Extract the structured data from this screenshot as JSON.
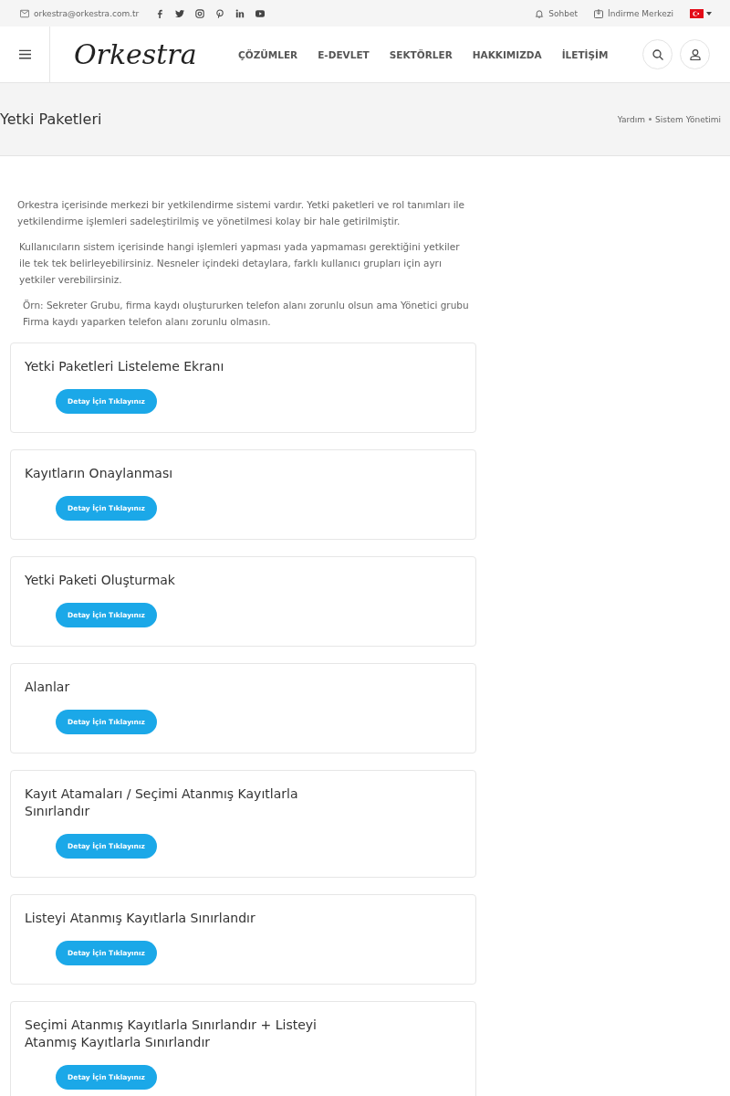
{
  "topbar": {
    "email": "orkestra@orkestra.com.tr",
    "links": [
      "Sohbet",
      "İndirme Merkezi"
    ]
  },
  "header": {
    "logo": "Orkestra",
    "nav": [
      "ÇÖZÜMLER",
      "E-DEVLET",
      "SEKTÖRLER",
      "HAKKIMIZDA",
      "İLETİŞİM"
    ]
  },
  "page_title": "Yetki Paketleri",
  "breadcrumb": [
    "Yardım",
    "Sistem Yönetimi"
  ],
  "paragraphs": [
    "Orkestra içerisinde merkezi bir yetkilendirme sistemi vardır. Yetki paketleri ve rol tanımları ile yetkilendirme işlemleri sadeleştirilmiş ve yönetilmesi kolay bir hale getirilmiştir.",
    "Kullanıcıların sistem içerisinde hangi işlemleri yapması yada yapmaması gerektiğini yetkiler ile tek tek belirleyebilirsiniz. Nesneler içindeki detaylara, farklı kullanıcı grupları için ayrı yetkiler verebilirsiniz.",
    "Örn: Sekreter Grubu, firma kaydı oluştururken telefon alanı zorunlu olsun ama Yönetici grubu Firma kaydı yaparken telefon alanı zorunlu olmasın."
  ],
  "cards": [
    {
      "title": "Yetki Paketleri Listeleme Ekranı",
      "button": "Detay İçin Tıklayınız"
    },
    {
      "title": "Kayıtların Onaylanması",
      "button": "Detay İçin Tıklayınız"
    },
    {
      "title": "Yetki Paketi Oluşturmak",
      "button": "Detay İçin Tıklayınız"
    },
    {
      "title": "Alanlar",
      "button": "Detay İçin Tıklayınız"
    },
    {
      "title": "Kayıt Atamaları / Seçimi Atanmış Kayıtlarla Sınırlandır",
      "button": "Detay İçin Tıklayınız"
    },
    {
      "title": "Listeyi Atanmış Kayıtlarla Sınırlandır",
      "button": "Detay İçin Tıklayınız"
    },
    {
      "title": "Seçimi Atanmış Kayıtlarla Sınırlandır + Listeyi Atanmış Kayıtlarla Sınırlandır",
      "button": "Detay İçin Tıklayınız"
    }
  ]
}
